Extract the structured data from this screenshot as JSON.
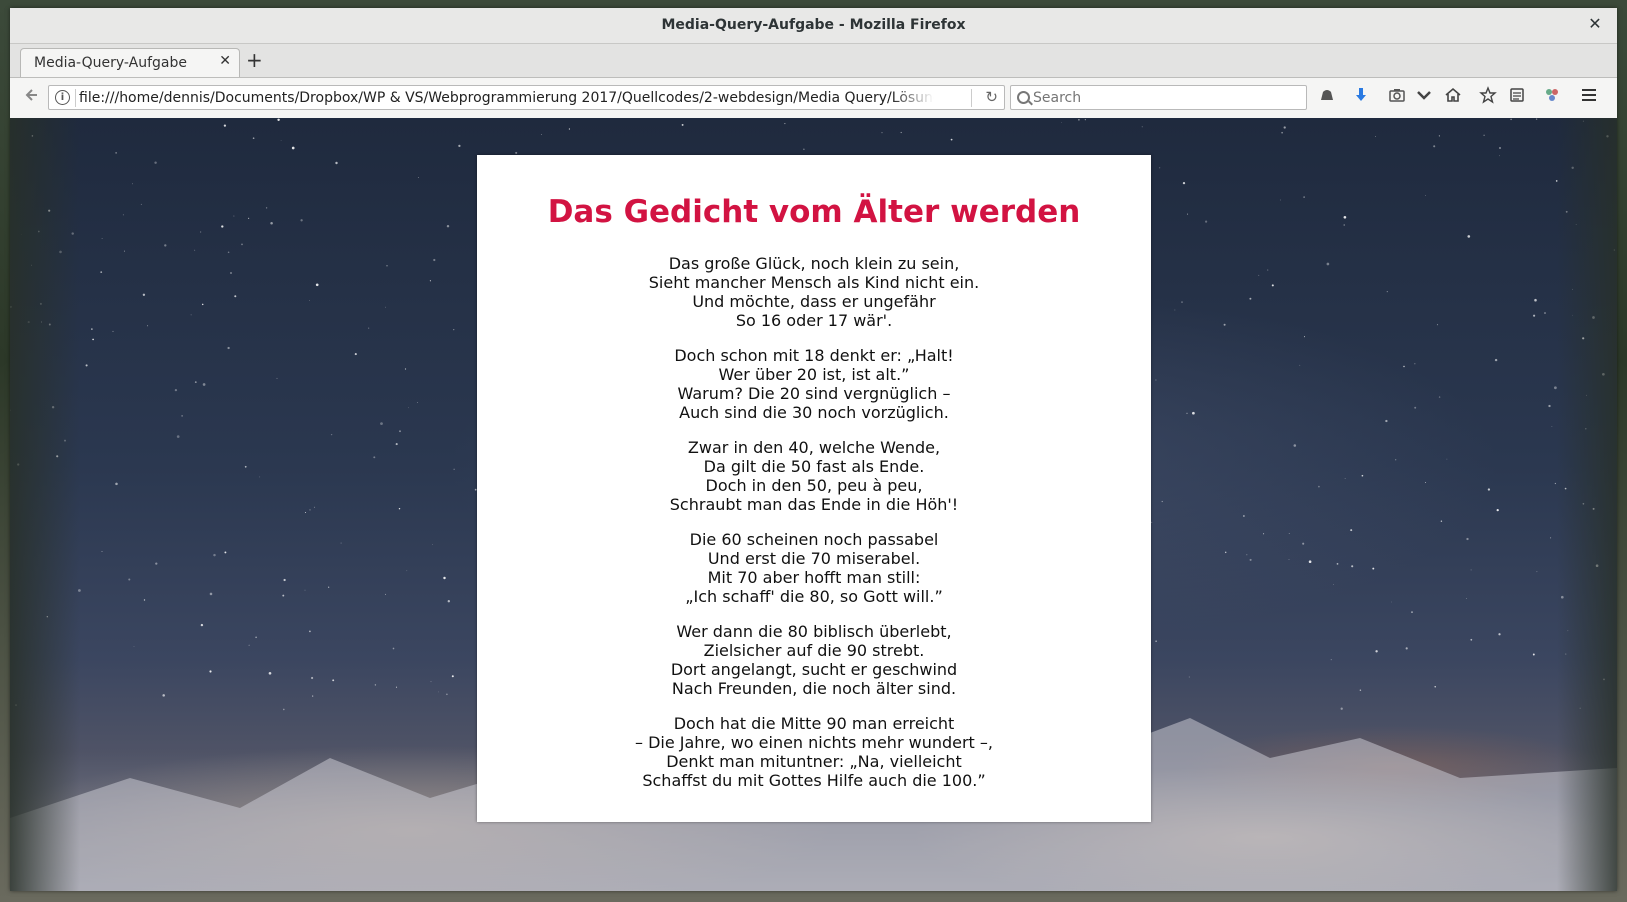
{
  "window": {
    "title": "Media-Query-Aufgabe - Mozilla Firefox",
    "close_glyph": "✕"
  },
  "tabs": [
    {
      "label": "Media-Query-Aufgabe",
      "close_glyph": "✕"
    }
  ],
  "new_tab_glyph": "+",
  "navbar": {
    "url": "file:///home/dennis/Documents/Dropbox/WP & VS/Webprogrammierung 2017/Quellcodes/2-webdesign/Media Query/Lösung/index.html",
    "search_placeholder": "Search",
    "toolbar_icons": [
      "sync-icon",
      "download-icon",
      "screenshot-icon",
      "pocket-icon",
      "home-icon",
      "bookmark-star-icon",
      "reader-icon",
      "extension-icon",
      "menu-icon"
    ]
  },
  "page": {
    "title": "Das Gedicht vom Älter werden",
    "stanzas": [
      [
        "Das große Glück, noch klein zu sein,",
        "Sieht mancher Mensch als Kind nicht ein.",
        "Und möchte, dass er ungefähr",
        "So 16 oder 17 wär'."
      ],
      [
        "Doch schon mit 18 denkt er: „Halt!",
        "Wer über 20 ist, ist alt.”",
        "Warum? Die 20 sind vergnüglich –",
        "Auch sind die 30 noch vorzüglich."
      ],
      [
        "Zwar in den 40, welche Wende,",
        "Da gilt die 50 fast als Ende.",
        "Doch in den 50, peu à peu,",
        "Schraubt man das Ende in die Höh'!"
      ],
      [
        "Die 60 scheinen noch passabel",
        "Und erst die 70 miserabel.",
        "Mit 70 aber hofft man still:",
        "„Ich schaff' die 80, so Gott will.”"
      ],
      [
        "Wer dann die 80 biblisch überlebt,",
        "Zielsicher auf die 90 strebt.",
        "Dort angelangt, sucht er geschwind",
        "Nach Freunden, die noch älter sind."
      ],
      [
        "Doch hat die Mitte 90 man erreicht",
        "– Die Jahre, wo einen nichts mehr wundert –,",
        "Denkt man mituntner: „Na, vielleicht",
        "Schaffst du mit Gottes Hilfe auch die 100.”"
      ]
    ]
  },
  "colors": {
    "title": "#d21342",
    "card": "#ffffff"
  }
}
